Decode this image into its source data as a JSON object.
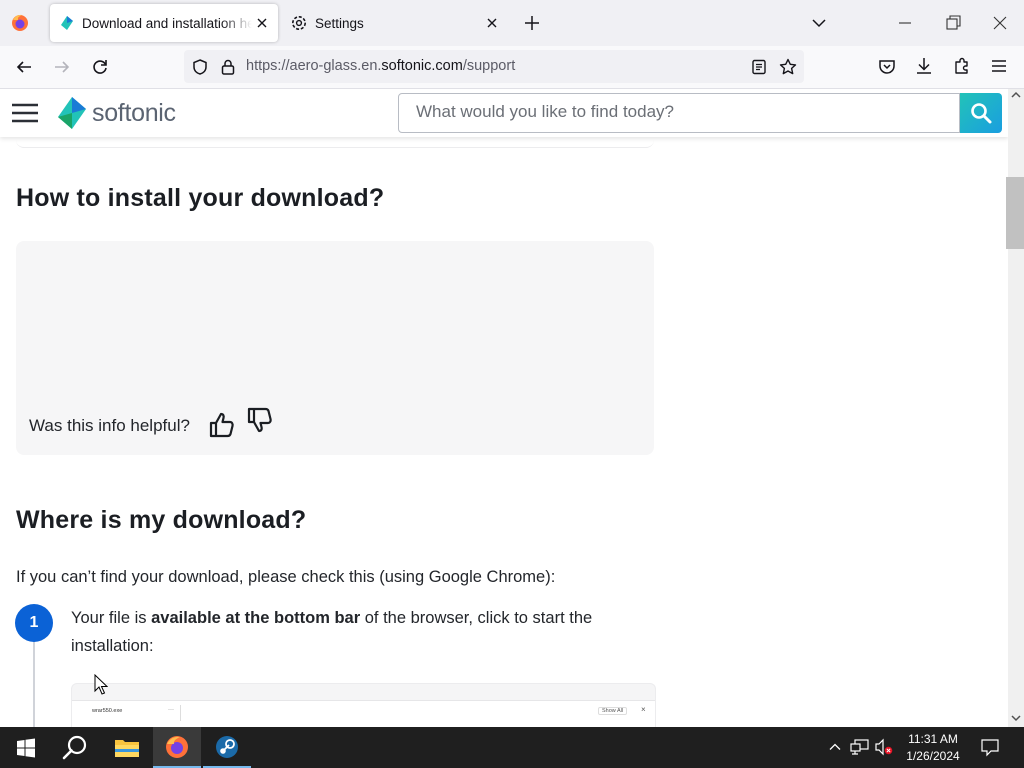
{
  "browser": {
    "tabs": [
      {
        "label": "Download and installation help",
        "active": true,
        "icon": "softonic-favicon"
      },
      {
        "label": "Settings",
        "active": false,
        "icon": "gear-icon"
      }
    ],
    "url": {
      "prefix": "https://aero-glass.en.",
      "host": "softonic.com",
      "path": "/support"
    }
  },
  "site": {
    "logo_text": "softonic",
    "search_placeholder": "What would you like to find today?"
  },
  "content": {
    "install_heading": "How to install your download?",
    "helpful_question": "Was this info helpful?",
    "where_heading": "Where is my download?",
    "where_intro": "If you can’t find your download, please check this (using Google Chrome):",
    "step1": {
      "number": "1",
      "text_before": "Your file is ",
      "text_bold": "available at the bottom bar",
      "text_after": " of the browser, click to start the installation:"
    },
    "preview": {
      "file_name": "wrar550.exe",
      "more": "···",
      "show_all": "Show All",
      "close": "×"
    }
  },
  "taskbar": {
    "time": "11:31 AM",
    "date": "1/26/2024",
    "apps": [
      "start",
      "search",
      "file-explorer",
      "firefox",
      "steam"
    ]
  },
  "colors": {
    "accent_blue": "#0b62d6",
    "softonic_green": "#22c3b8",
    "taskbar": "#1f1f1f"
  }
}
